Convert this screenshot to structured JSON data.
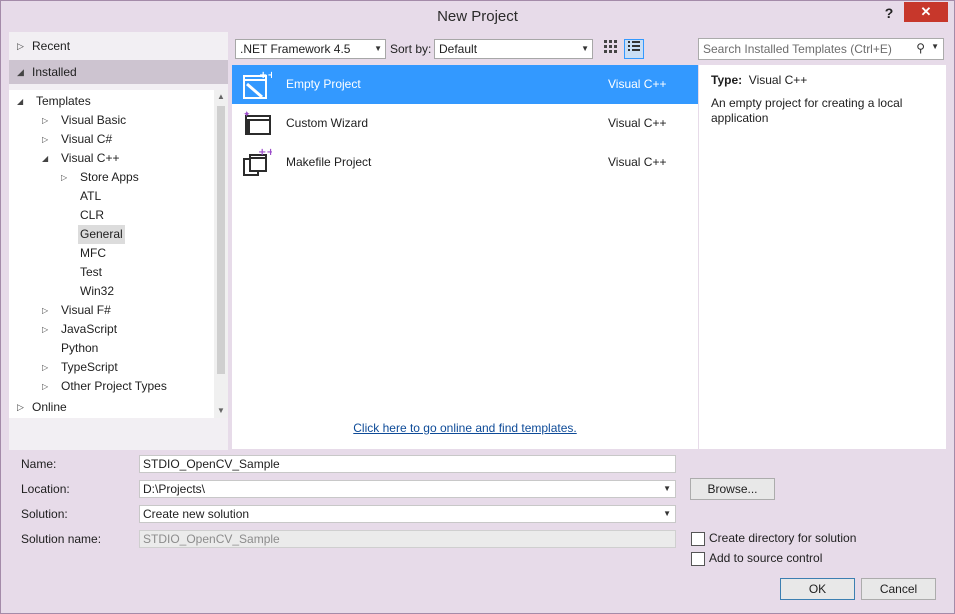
{
  "window": {
    "title": "New Project",
    "help_glyph": "?",
    "close_glyph": "✕"
  },
  "left": {
    "recent": "Recent",
    "installed": "Installed",
    "online": "Online",
    "tree": [
      {
        "label": "Templates",
        "expander": "◢",
        "level": 0
      },
      {
        "label": "Visual Basic",
        "expander": "▷",
        "level": 1
      },
      {
        "label": "Visual C#",
        "expander": "▷",
        "level": 1
      },
      {
        "label": "Visual C++",
        "expander": "◢",
        "level": 1
      },
      {
        "label": "Store Apps",
        "expander": "▷",
        "level": 2
      },
      {
        "label": "ATL",
        "expander": "",
        "level": 2
      },
      {
        "label": "CLR",
        "expander": "",
        "level": 2
      },
      {
        "label": "General",
        "expander": "",
        "level": 2,
        "selected": true
      },
      {
        "label": "MFC",
        "expander": "",
        "level": 2
      },
      {
        "label": "Test",
        "expander": "",
        "level": 2
      },
      {
        "label": "Win32",
        "expander": "",
        "level": 2
      },
      {
        "label": "Visual F#",
        "expander": "▷",
        "level": 1
      },
      {
        "label": "JavaScript",
        "expander": "▷",
        "level": 1
      },
      {
        "label": "Python",
        "expander": "",
        "level": 1
      },
      {
        "label": "TypeScript",
        "expander": "▷",
        "level": 1
      },
      {
        "label": "Other Project Types",
        "expander": "▷",
        "level": 1
      }
    ]
  },
  "toolbar": {
    "framework": ".NET Framework 4.5",
    "sort_label": "Sort by:",
    "sort_value": "Default",
    "search_placeholder": "Search Installed Templates (Ctrl+E)"
  },
  "templates": [
    {
      "name": "Empty Project",
      "lang": "Visual C++",
      "selected": true
    },
    {
      "name": "Custom Wizard",
      "lang": "Visual C++",
      "selected": false
    },
    {
      "name": "Makefile Project",
      "lang": "Visual C++",
      "selected": false
    }
  ],
  "online_link": "Click here to go online and find templates.",
  "details": {
    "type_label": "Type:",
    "type_value": "Visual C++",
    "description": "An empty project for creating a local application"
  },
  "form": {
    "name_label": "Name:",
    "name_value": "STDIO_OpenCV_Sample",
    "location_label": "Location:",
    "location_value": "D:\\Projects\\",
    "solution_label": "Solution:",
    "solution_value": "Create new solution",
    "solution_name_label": "Solution name:",
    "solution_name_value": "STDIO_OpenCV_Sample",
    "browse": "Browse...",
    "create_dir": "Create directory for solution",
    "create_dir_checked": false,
    "source_control": "Add to source control",
    "source_control_checked": false,
    "ok": "OK",
    "cancel": "Cancel"
  },
  "colors": {
    "accent": "#3399ff",
    "link": "#0e4b98",
    "chrome": "#e7dbe9",
    "close": "#c7372b"
  }
}
